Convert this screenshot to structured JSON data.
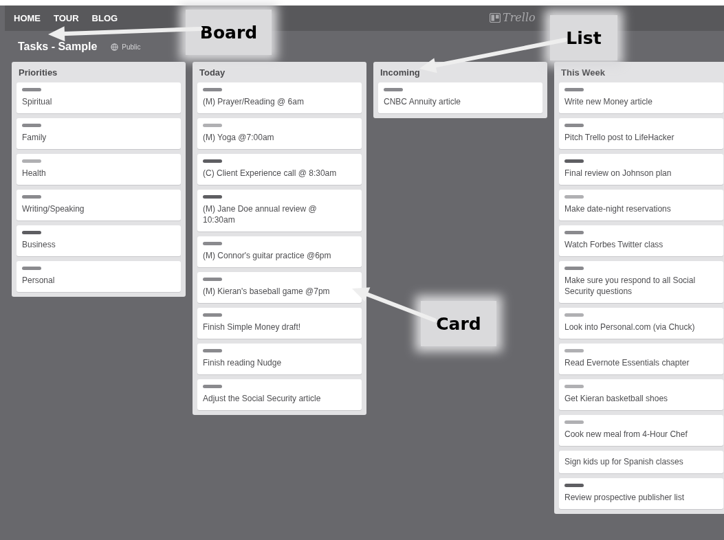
{
  "nav": [
    "HOME",
    "TOUR",
    "BLOG"
  ],
  "logo": "Trello",
  "board": {
    "title": "Tasks - Sample",
    "visibility": "Public"
  },
  "lists": [
    {
      "title": "Priorities",
      "cards": [
        {
          "text": "Spiritual",
          "color": "#8a8a8e"
        },
        {
          "text": "Family",
          "color": "#8a8a8e"
        },
        {
          "text": "Health",
          "color": "#b0b0b3"
        },
        {
          "text": "Writing/Speaking",
          "color": "#8a8a8e"
        },
        {
          "text": "Business",
          "color": "#5e5e62"
        },
        {
          "text": "Personal",
          "color": "#8a8a8e"
        }
      ]
    },
    {
      "title": "Today",
      "cards": [
        {
          "text": "(M) Prayer/Reading @ 6am",
          "color": "#8a8a8e"
        },
        {
          "text": "(M) Yoga @7:00am",
          "color": "#b0b0b3"
        },
        {
          "text": "(C) Client Experience call @ 8:30am",
          "color": "#5e5e62"
        },
        {
          "text": "(M) Jane Doe annual review @ 10:30am",
          "color": "#5e5e62"
        },
        {
          "text": "(M) Connor's guitar practice @6pm",
          "color": "#8a8a8e"
        },
        {
          "text": "(M) Kieran's baseball game @7pm",
          "color": "#8a8a8e"
        },
        {
          "text": "Finish Simple Money draft!",
          "color": "#8a8a8e"
        },
        {
          "text": "Finish reading Nudge",
          "color": "#8a8a8e"
        },
        {
          "text": "Adjust the Social Security article",
          "color": "#8a8a8e"
        }
      ]
    },
    {
      "title": "Incoming",
      "cards": [
        {
          "text": "CNBC Annuity article",
          "color": "#8a8a8e"
        }
      ]
    },
    {
      "title": "This Week",
      "cards": [
        {
          "text": "Write new Money article",
          "color": "#8a8a8e"
        },
        {
          "text": "Pitch Trello post to LifeHacker",
          "color": "#8a8a8e"
        },
        {
          "text": "Final review on Johnson plan",
          "color": "#5e5e62"
        },
        {
          "text": "Make date-night reservations",
          "color": "#b0b0b3"
        },
        {
          "text": "Watch Forbes Twitter class",
          "color": "#8a8a8e"
        },
        {
          "text": "Make sure you respond to all Social Security questions",
          "color": "#8a8a8e"
        },
        {
          "text": "Look into Personal.com (via Chuck)",
          "color": "#b0b0b3"
        },
        {
          "text": "Read Evernote Essentials chapter",
          "color": "#b0b0b3"
        },
        {
          "text": "Get Kieran basketball shoes",
          "color": "#b0b0b3"
        },
        {
          "text": "Cook new meal from 4-Hour Chef",
          "color": "#b0b0b3"
        },
        {
          "text": "Sign kids up for Spanish classes"
        },
        {
          "text": "Review prospective publisher list",
          "color": "#5e5e62"
        }
      ]
    }
  ],
  "annotations": [
    {
      "label": "Board"
    },
    {
      "label": "List"
    },
    {
      "label": "Card"
    }
  ]
}
